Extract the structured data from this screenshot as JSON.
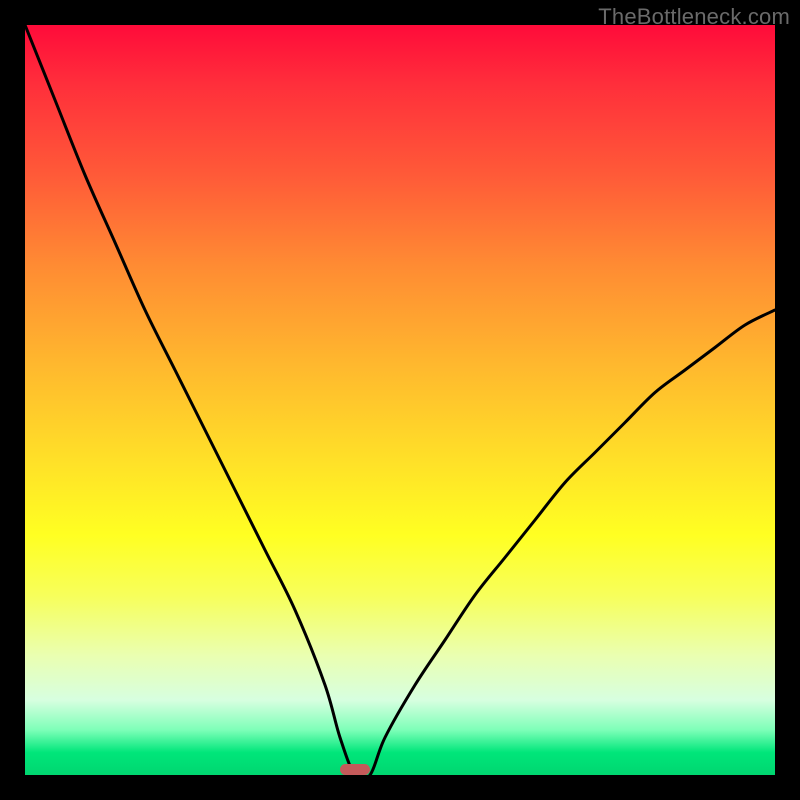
{
  "watermark": "TheBottleneck.com",
  "colors": {
    "frame": "#000000",
    "curve": "#000000",
    "marker": "#c45a5a",
    "watermark": "#6a6a6a"
  },
  "chart_data": {
    "type": "line",
    "title": "",
    "xlabel": "",
    "ylabel": "",
    "xlim": [
      0,
      100
    ],
    "ylim": [
      0,
      100
    ],
    "grid": false,
    "legend": null,
    "note": "No axis ticks or labels are rendered in the image; values are positional estimates read from pixel geometry on a 0–100 normalized scale. The curve is a V-shape touching y≈0 near x≈44 and rising to y≈100 at x≈0 and y≈62 at x≈100.",
    "series": [
      {
        "name": "bottleneck-curve",
        "x": [
          0,
          4,
          8,
          12,
          16,
          20,
          24,
          28,
          32,
          36,
          40,
          42,
          44,
          46,
          48,
          52,
          56,
          60,
          64,
          68,
          72,
          76,
          80,
          84,
          88,
          92,
          96,
          100
        ],
        "y": [
          100,
          90,
          80,
          71,
          62,
          54,
          46,
          38,
          30,
          22,
          12,
          5,
          0,
          0,
          5,
          12,
          18,
          24,
          29,
          34,
          39,
          43,
          47,
          51,
          54,
          57,
          60,
          62
        ]
      }
    ],
    "min_marker": {
      "x": 44,
      "y": 0,
      "w": 4,
      "h": 1.5
    }
  }
}
